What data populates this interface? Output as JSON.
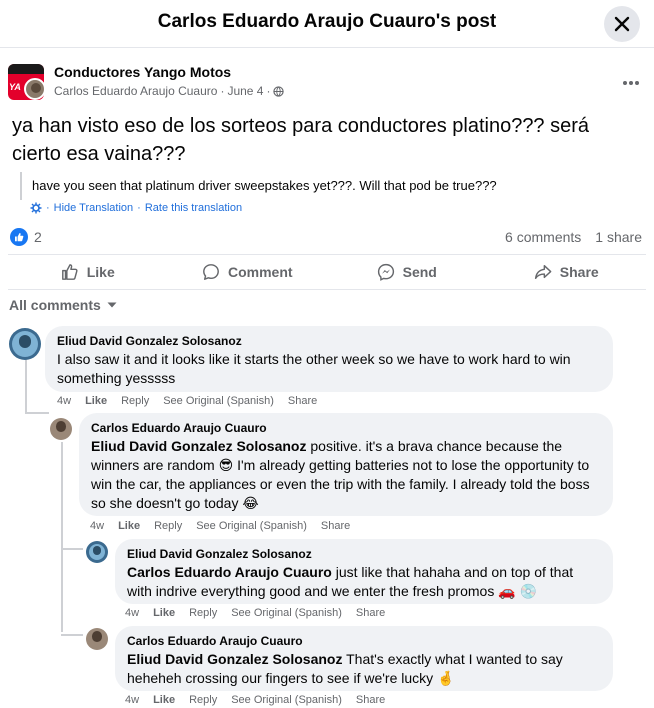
{
  "header": {
    "title": "Carlos Eduardo Araujo Cuauro's post"
  },
  "post": {
    "group_name": "Conductores Yango Motos",
    "author": "Carlos Eduardo Araujo Cuauro",
    "date": "June 4",
    "separator": "·",
    "text": "ya han visto eso de los sorteos para conductores platino??? será cierto esa vaina???",
    "translation": "have you seen that platinum driver sweepstakes yet???. Will that pod be true???",
    "hide_translation": "Hide Translation",
    "rate_translation": "Rate this translation",
    "reaction_count": "2",
    "comments_count": "6 comments",
    "shares_count": "1 share"
  },
  "actions": {
    "like": "Like",
    "comment": "Comment",
    "send": "Send",
    "share": "Share"
  },
  "comments_filter": "All comments",
  "comments": [
    {
      "author": "Eliud David Gonzalez Solosanoz",
      "mention": "",
      "text": "I also saw it and it looks like it starts the other week so we have to work hard to win something yesssss",
      "time": "4w",
      "like": "Like",
      "reply": "Reply",
      "see_original": "See Original (Spanish)",
      "share": "Share"
    },
    {
      "author": "Carlos Eduardo Araujo Cuauro",
      "mention": "Eliud David Gonzalez Solosanoz",
      "text": " positive. it's a brava chance because the winners are random 😎 I'm already getting batteries not to lose the opportunity to win the car, the appliances or even the trip with the family. I already told the boss so she doesn't go today 😂",
      "time": "4w",
      "like": "Like",
      "reply": "Reply",
      "see_original": "See Original (Spanish)",
      "share": "Share"
    },
    {
      "author": "Eliud David Gonzalez Solosanoz",
      "mention": "Carlos Eduardo Araujo Cuauro",
      "text": " just like that hahaha and on top of that with indrive everything good and we enter the fresh promos 🚗 💿",
      "time": "4w",
      "like": "Like",
      "reply": "Reply",
      "see_original": "See Original (Spanish)",
      "share": "Share"
    },
    {
      "author": "Carlos Eduardo Araujo Cuauro",
      "mention": "Eliud David Gonzalez Solosanoz",
      "text": " That's exactly what I wanted to say heheheh crossing our fingers to see if we're lucky 🤞",
      "time": "4w",
      "like": "Like",
      "reply": "Reply",
      "see_original": "See Original (Spanish)",
      "share": "Share"
    }
  ],
  "icons": {
    "close": "close-icon",
    "more": "more-icon",
    "globe": "globe-icon",
    "translate": "translate-icon",
    "like_reaction": "like-reaction-icon",
    "like": "thumbs-up-icon",
    "comment": "comment-icon",
    "send": "messenger-icon",
    "share": "share-arrow-icon",
    "dropdown": "chevron-down-icon"
  },
  "colors": {
    "accent": "#1877f2",
    "link": "#216fdb",
    "muted": "#65676b",
    "bubble": "#f0f2f5",
    "brand": "#e3002b"
  }
}
